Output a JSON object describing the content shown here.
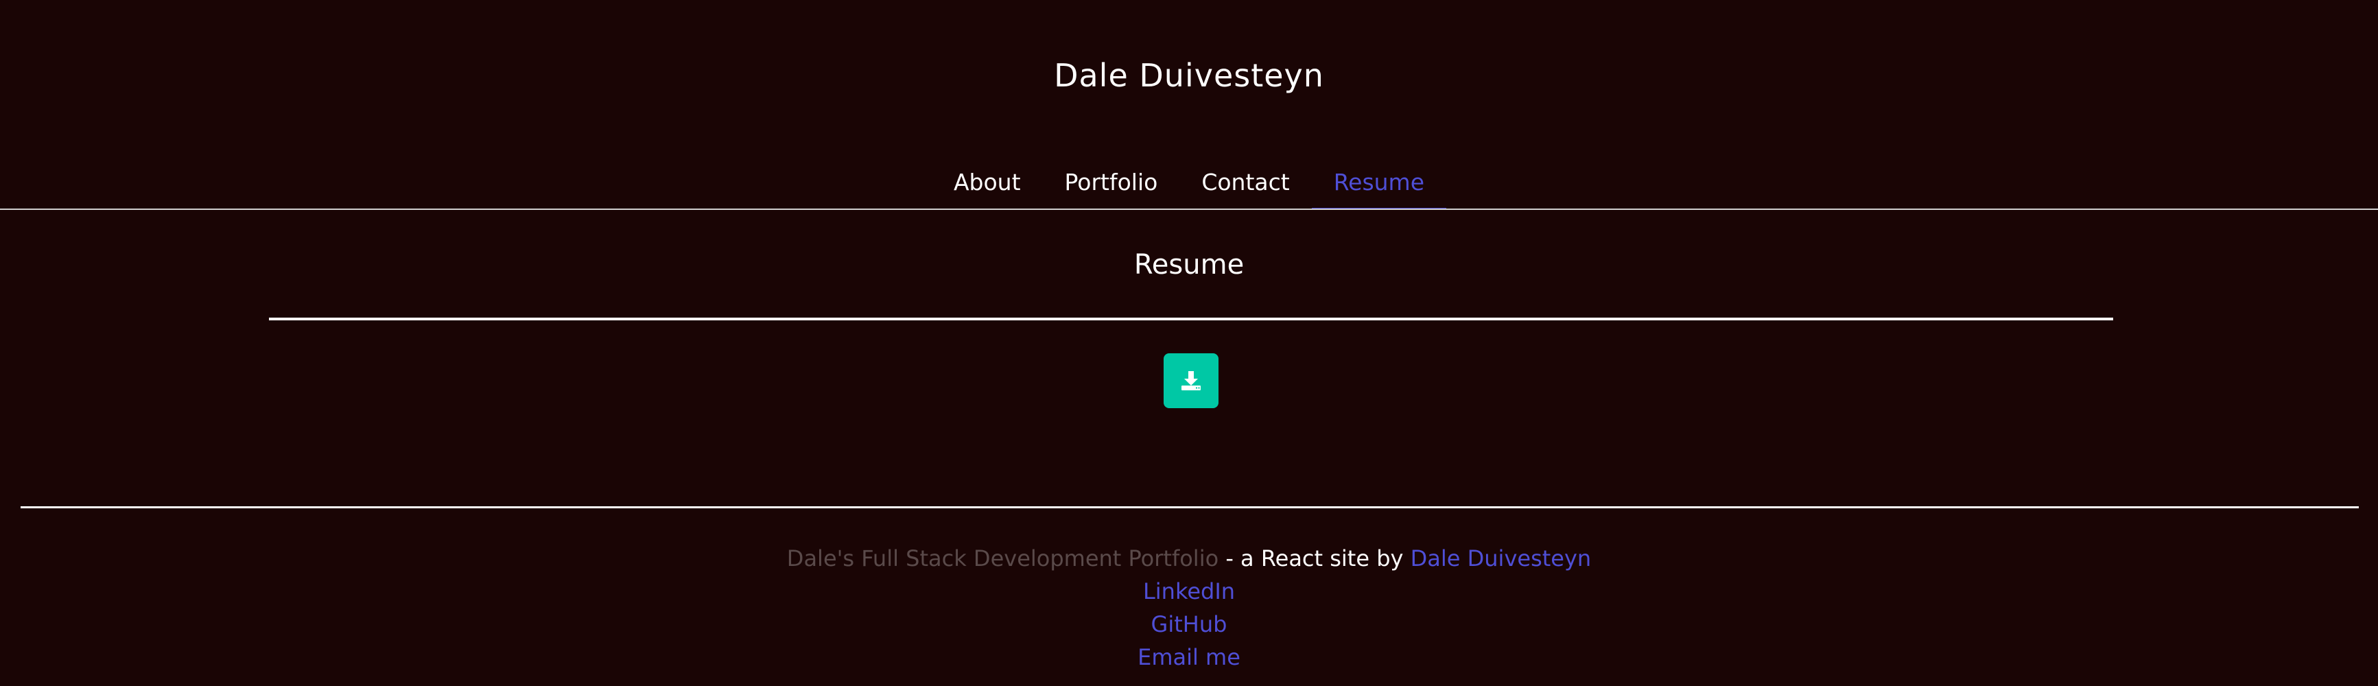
{
  "header": {
    "title": "Dale Duivesteyn"
  },
  "nav": {
    "items": [
      {
        "label": "About"
      },
      {
        "label": "Portfolio"
      },
      {
        "label": "Contact"
      },
      {
        "label": "Resume"
      }
    ],
    "active": "Resume"
  },
  "main": {
    "section_title": "Resume",
    "download_icon": "download-icon"
  },
  "footer": {
    "portfolio_text": "Dale's Full Stack Development Portfolio",
    "middle_text": " - a React site by ",
    "author_link": "Dale Duivesteyn",
    "links": [
      {
        "label": "LinkedIn"
      },
      {
        "label": "GitHub"
      },
      {
        "label": "Email me"
      }
    ]
  },
  "colors": {
    "background": "#1a0505",
    "accent": "#4f4fd6",
    "button": "#00c8a5"
  }
}
